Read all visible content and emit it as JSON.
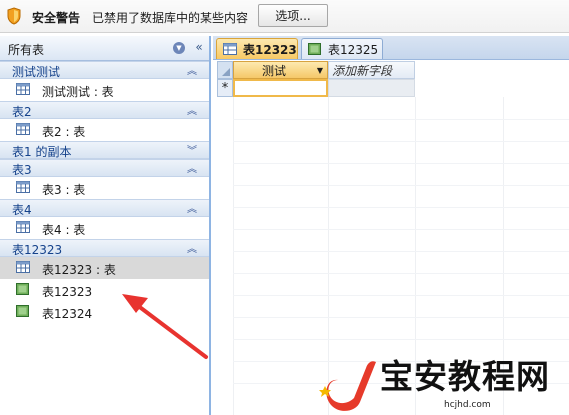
{
  "security_bar": {
    "title": "安全警告",
    "message": "已禁用了数据库中的某些内容",
    "options_button": "选项..."
  },
  "nav_pane": {
    "header": "所有表",
    "groups": [
      {
        "label": "测试测试",
        "items": [
          {
            "label": "测试测试 : 表",
            "icon": "table-icon"
          }
        ]
      },
      {
        "label": "表2",
        "items": [
          {
            "label": "表2 : 表",
            "icon": "table-icon"
          }
        ]
      },
      {
        "label": "表1 的副本",
        "collapsed": true,
        "items": []
      },
      {
        "label": "表3",
        "items": [
          {
            "label": "表3 : 表",
            "icon": "table-icon"
          }
        ]
      },
      {
        "label": "表4",
        "items": [
          {
            "label": "表4 : 表",
            "icon": "table-icon"
          }
        ]
      },
      {
        "label": "表12323",
        "items": [
          {
            "label": "表12323 : 表",
            "icon": "table-icon",
            "selected": true
          },
          {
            "label": "表12323",
            "icon": "form-icon"
          },
          {
            "label": "表12324",
            "icon": "form-icon"
          }
        ]
      }
    ]
  },
  "tabs": [
    {
      "label": "表12323",
      "icon": "table-icon",
      "active": true
    },
    {
      "label": "表12325",
      "icon": "form-icon",
      "active": false
    }
  ],
  "datasheet": {
    "columns": [
      "测试",
      "添加新字段"
    ],
    "new_row_marker": "*"
  },
  "watermark": {
    "text": "宝安教程网",
    "url": "hcjhd.com"
  },
  "colors": {
    "accent_orange": "#f5c869",
    "nav_blue": "#15428b",
    "arrow_red": "#e8332f"
  }
}
